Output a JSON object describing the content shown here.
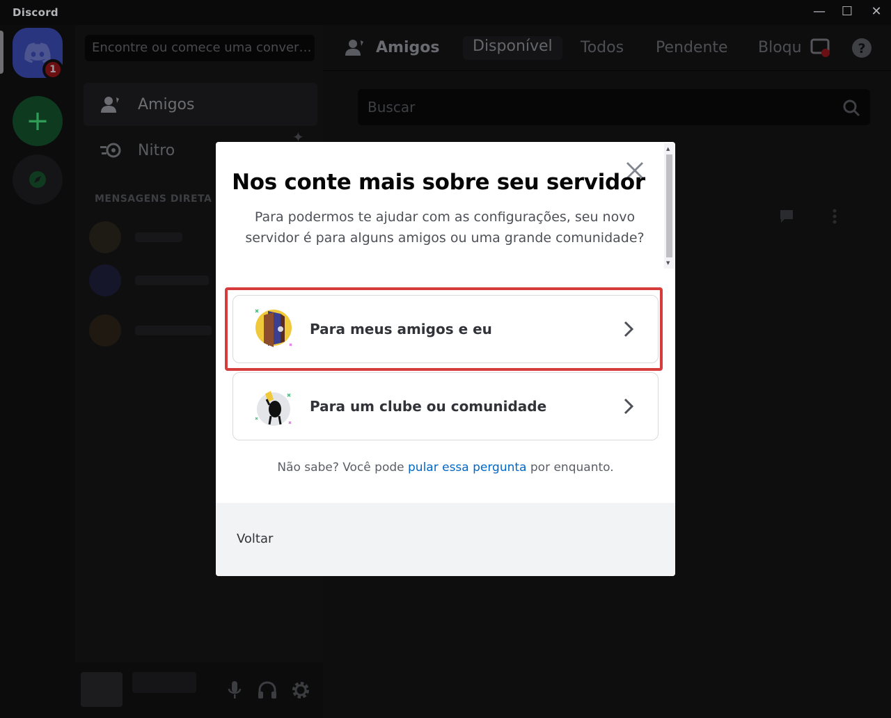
{
  "window": {
    "title": "Discord",
    "buttons": {
      "minimize": "—",
      "maximize": "☐",
      "close": "✕"
    }
  },
  "servers": {
    "home_badge": "1",
    "add_label": "+"
  },
  "sidebar": {
    "search_placeholder": "Encontre ou comece uma conver…",
    "nav": [
      {
        "label": "Amigos",
        "icon": "friends-icon"
      },
      {
        "label": "Nitro",
        "icon": "nitro-icon"
      }
    ],
    "dm_header": "MENSAGENS DIRETA"
  },
  "topbar": {
    "title": "Amigos",
    "tabs": [
      "Disponível",
      "Todos",
      "Pendente",
      "Bloqu"
    ]
  },
  "main": {
    "search_placeholder": "Buscar"
  },
  "modal": {
    "title": "Nos conte mais sobre seu servidor",
    "subtitle": "Para podermos te ajudar com as configurações, seu novo servidor é para alguns amigos ou uma grande comunidade?",
    "options": [
      {
        "label": "Para meus amigos e eu",
        "icon": "door-illustration-icon"
      },
      {
        "label": "Para um clube ou comunidade",
        "icon": "foam-finger-illustration-icon"
      }
    ],
    "skip_prefix": "Não sabe? Você pode ",
    "skip_link": "pular essa pergunta",
    "skip_suffix": " por enquanto.",
    "back_label": "Voltar"
  },
  "colors": {
    "highlight": "#d63c3c",
    "link": "#0067c7"
  }
}
